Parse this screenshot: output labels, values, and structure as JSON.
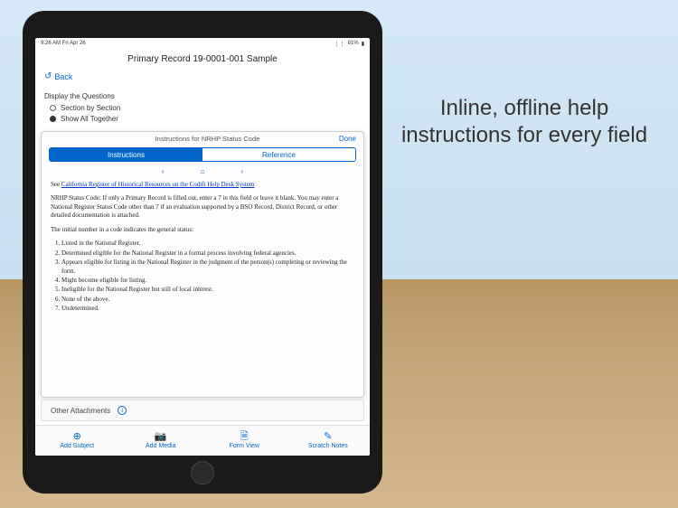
{
  "marketing": {
    "headline": "Inline, offline help instructions for every field"
  },
  "statusBar": {
    "time": "9:26 AM  Fri Apr 26",
    "battery": "81%"
  },
  "page": {
    "title": "Primary Record 19-0001-001 Sample",
    "backLabel": "Back"
  },
  "display": {
    "label": "Display the Questions",
    "options": [
      "Section by Section",
      "Show All Together"
    ],
    "selectedIndex": 1
  },
  "modal": {
    "title": "Instructions for NRHP Status Code",
    "done": "Done",
    "tabs": [
      "Instructions",
      "Reference"
    ],
    "activeTab": 0,
    "seePrefix": "See ",
    "seeLink": "California Register of Historical Resources on the Codifi Help Desk System",
    "para1": "NRHP Status Code: If only a Primary Record is filled out, enter a 7 in this field or leave it blank. You may enter a National Register Status Code other than 7 if an evaluation supported by a BSO Record, District Record, or other detailed documentation is attached.",
    "para2": "The initial number in a code indicates the general status:",
    "list": [
      "Listed in the National Register.",
      "Determined eligible for the National Register in a formal process involving federal agencies.",
      "Appears eligible for listing in the National Register in the judgment of the person(s) completing or reviewing the form.",
      "Might become eligible for listing.",
      "Ineligible for the National Register but still of local interest.",
      "None of the above.",
      "Undetermined."
    ]
  },
  "attachments": {
    "label": "Other Attachments"
  },
  "toolbar": {
    "items": [
      {
        "icon": "⊕",
        "label": "Add Subject"
      },
      {
        "icon": "📷",
        "label": "Add Media"
      },
      {
        "icon": "🗎",
        "label": "Form View"
      },
      {
        "icon": "✎",
        "label": "Scratch Notes"
      }
    ]
  }
}
